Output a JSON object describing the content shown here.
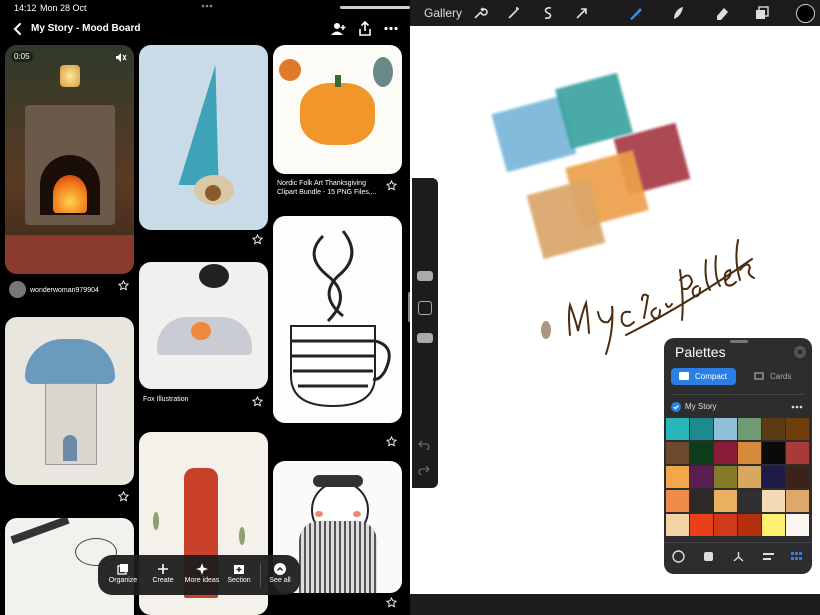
{
  "status": {
    "time": "14:12",
    "date": "Mon 28 Oct"
  },
  "board": {
    "title": "My Story - Mood Board",
    "video_time": "0:05",
    "pins": [
      {
        "caption": "wonderwoman979904"
      },
      {
        "caption": "Nordic Folk Art Thanksgiving Clipart Bundle - 15 PNG Files,..."
      },
      {
        "caption": "Fox Illustration"
      }
    ]
  },
  "toolbar": {
    "organize": "Organize",
    "create": "Create",
    "more_ideas": "More ideas",
    "section": "Section",
    "see_all": "See all"
  },
  "procreate": {
    "gallery": "Gallery",
    "palettes": {
      "title": "Palettes",
      "compact_tab": "Compact",
      "cards_tab": "Cards",
      "palette_name": "My Story",
      "swatches": [
        "#2ab5b8",
        "#1d8a8e",
        "#8fbfd9",
        "#6f9a72",
        "#5a3a12",
        "#6e3f0b",
        "#6b4a2e",
        "#0e3b1a",
        "#8a1c3a",
        "#d68a3a",
        "#0a0a0a",
        "#a83a3a",
        "#f2a84a",
        "#5a1f52",
        "#857a25",
        "#d8a760",
        "#1e1a4a",
        "#3a2418",
        "#f08a4a",
        "#2e2a2a",
        "#e8b060",
        "#303030",
        "#f3d9b5",
        "#e0a76a",
        "#f3d2a6",
        "#e8401a",
        "#d03a1a",
        "#b5300f",
        "#fff170",
        "#faf6ee"
      ]
    },
    "colors": {
      "blue": "#6fb0d6",
      "teal": "#3aa3a0",
      "red": "#a63a45",
      "sand": "#dba66a",
      "orange": "#eda04a",
      "ink": "#4a2d10"
    }
  }
}
